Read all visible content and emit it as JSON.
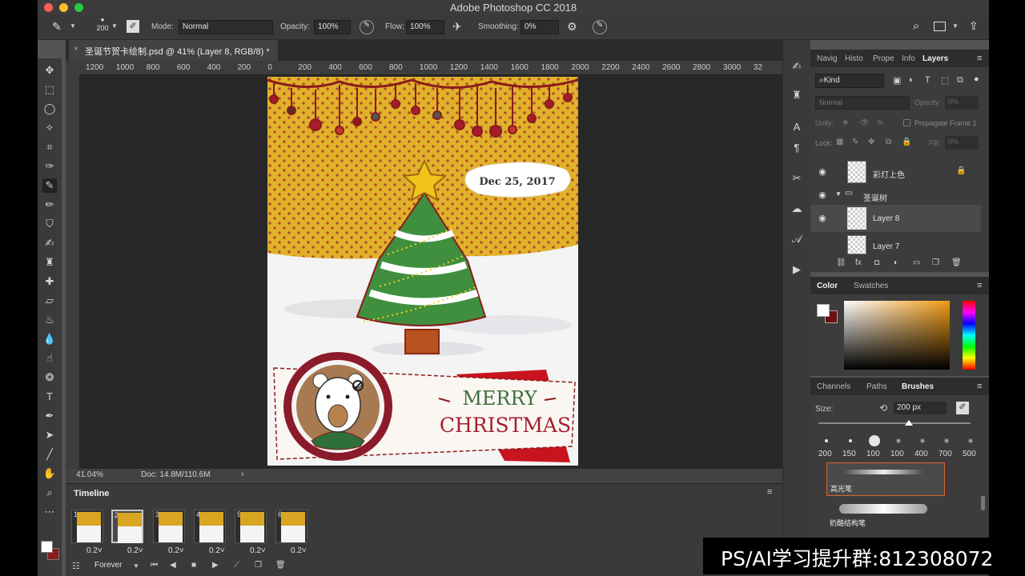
{
  "app": {
    "title": "Adobe Photoshop CC 2018",
    "document_tab": "圣诞节贺卡绘制.psd @ 41% (Layer 8, RGB/8) *"
  },
  "options_bar": {
    "brush_size": "200",
    "mode_label": "Mode:",
    "mode_value": "Normal",
    "opacity_label": "Opacity:",
    "opacity_value": "100%",
    "flow_label": "Flow:",
    "flow_value": "100%",
    "smoothing_label": "Smoothing:",
    "smoothing_value": "0%"
  },
  "ruler": {
    "h_ticks": [
      "1200",
      "1000",
      "800",
      "600",
      "400",
      "200",
      "0",
      "200",
      "400",
      "600",
      "800",
      "1000",
      "1200",
      "1400",
      "1600",
      "1800",
      "2000",
      "2200",
      "2400",
      "2600",
      "2800",
      "3000",
      "32"
    ]
  },
  "artwork": {
    "date_text": "Dec 25, 2017",
    "merry": "MERRY",
    "christmas": "CHRISTMAS"
  },
  "status": {
    "zoom": "41.04%",
    "doc_info": "Doc: 14.8M/110.6M"
  },
  "timeline": {
    "title": "Timeline",
    "loop": "Forever",
    "frames": [
      {
        "num": "1",
        "duration": "0.2"
      },
      {
        "num": "2",
        "duration": "0.2"
      },
      {
        "num": "3",
        "duration": "0.2"
      },
      {
        "num": "4",
        "duration": "0.2"
      },
      {
        "num": "5",
        "duration": "0.2"
      },
      {
        "num": "6",
        "duration": "0.2"
      }
    ]
  },
  "layers_panel": {
    "tabs": [
      "Navig",
      "Histo",
      "Prope",
      "Info",
      "Layers"
    ],
    "filter": "Kind",
    "blend": "Normal",
    "opacity_label": "Opacity:",
    "opacity_value": "0%",
    "unify_label": "Unify:",
    "propagate": "Propagate Frame 1",
    "lock_label": "Lock:",
    "fill_label": "Fill:",
    "fill_value": "0%",
    "layers": [
      {
        "name": "彩灯上色"
      },
      {
        "name": "圣诞树"
      },
      {
        "name": "Layer 8"
      },
      {
        "name": "Layer 7"
      }
    ]
  },
  "color_panel": {
    "tabs": [
      "Color",
      "Swatches"
    ]
  },
  "brushes_panel": {
    "tabs": [
      "Channels",
      "Paths",
      "Brushes"
    ],
    "size_label": "Size:",
    "size_value": "200 px",
    "presets": [
      "200",
      "150",
      "100",
      "100",
      "400",
      "700",
      "500"
    ],
    "brush_names": [
      "高光笔",
      "奶酪结构笔"
    ]
  },
  "watermark": "PS/AI学习提升群:812308072"
}
